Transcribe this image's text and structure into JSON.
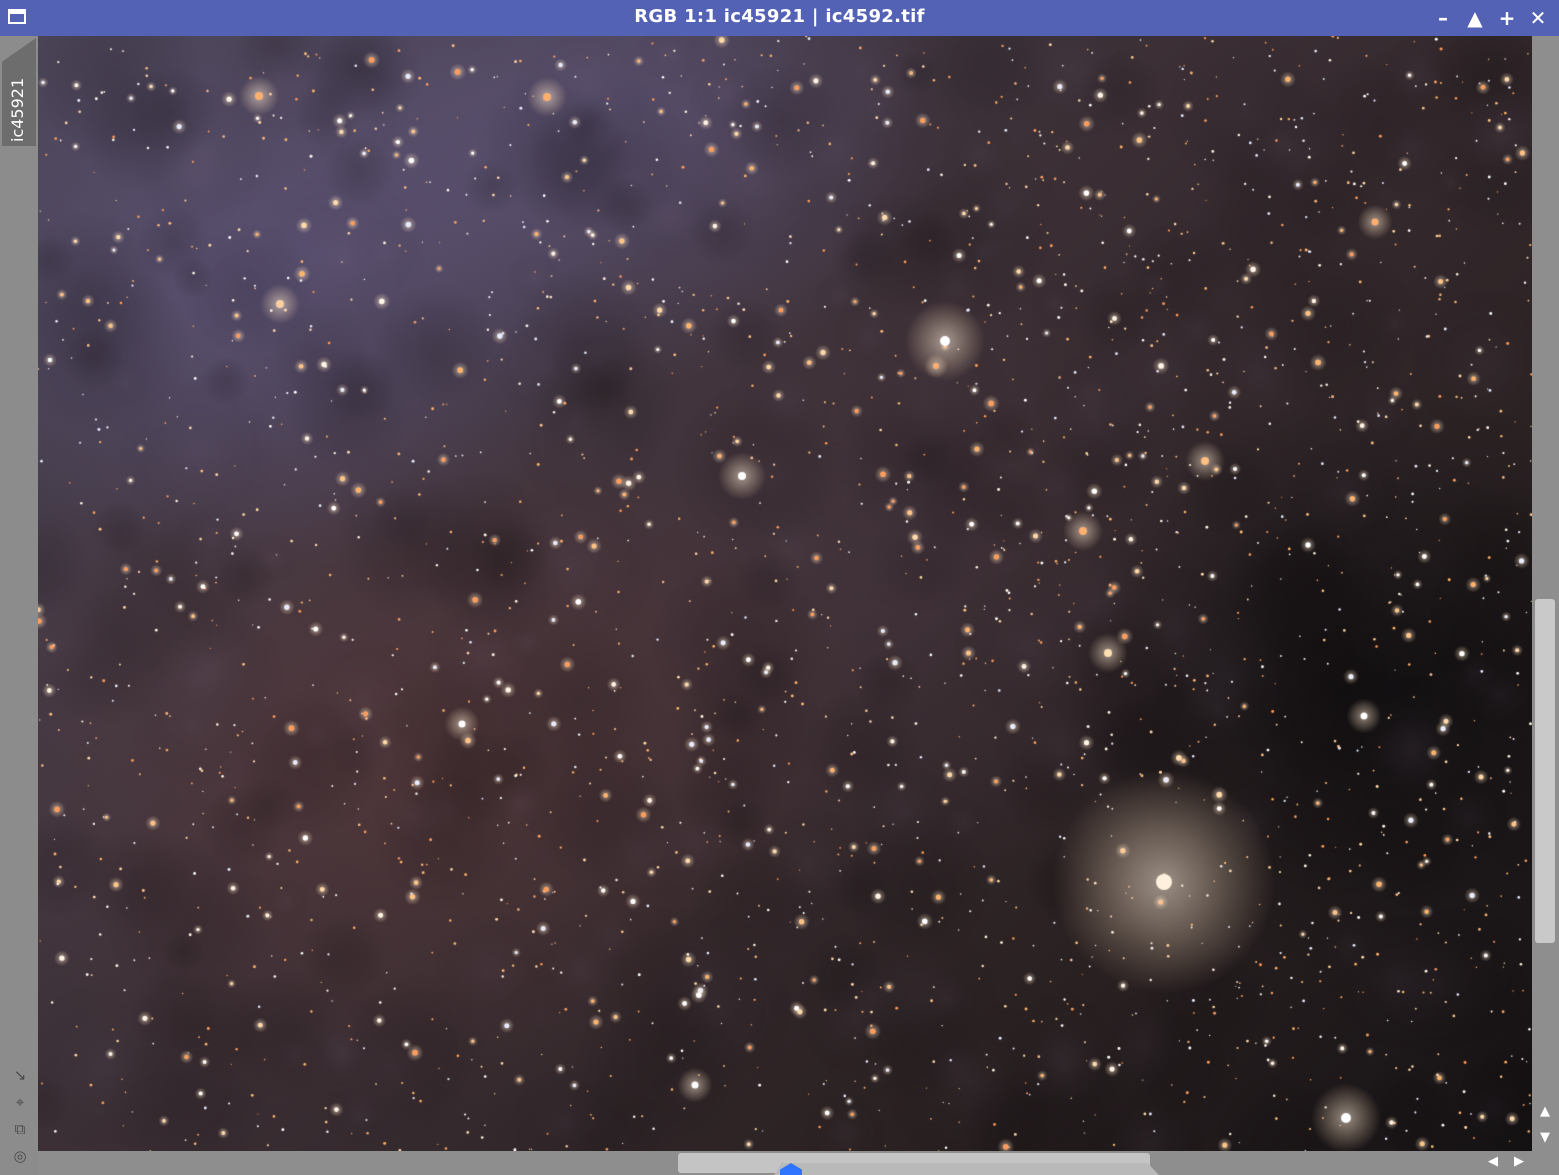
{
  "window": {
    "title": "RGB 1:1 ic45921 | ic4592.tif",
    "view_tab_label": "ic45921",
    "controls": {
      "minimize_icon": "minimize-icon",
      "shade_icon": "shade-icon",
      "maximize_icon": "maximize-icon",
      "close_icon": "close-icon"
    },
    "colors": {
      "titlebar": "#5462b6",
      "frame": "#8c8c8c",
      "scroll_marker": "#2f74ff"
    }
  },
  "image": {
    "subject": "star field",
    "zoom": "1:1",
    "channel_mode": "RGB"
  },
  "scrollbars": {
    "vertical_position": 0.5,
    "horizontal_position": 0.43
  }
}
